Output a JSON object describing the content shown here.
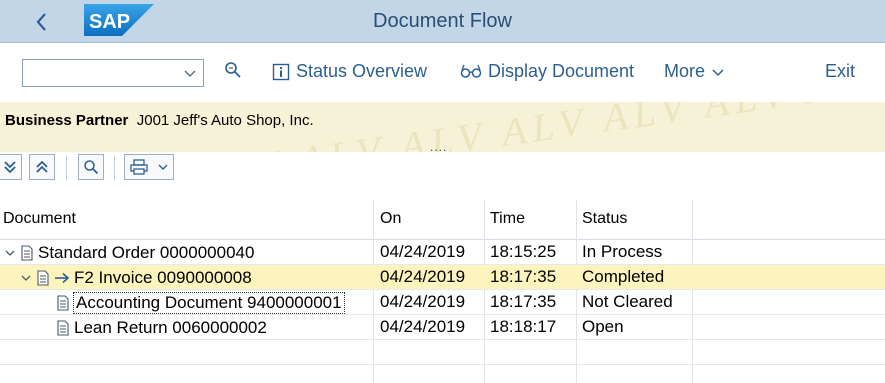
{
  "header": {
    "back_label": "<",
    "logo_text": "SAP",
    "title": "Document Flow"
  },
  "toolbar": {
    "combo_value": "",
    "status_overview": "Status Overview",
    "display_document": "Display Document",
    "more": "More",
    "exit": "Exit"
  },
  "partner": {
    "label": "Business Partner",
    "value": "J001 Jeff's Auto Shop, Inc."
  },
  "watermark": "ALV ALV ALV ALV ALV ALV ALV ALV ALV ALV ALV ALV",
  "splitter": "....",
  "table": {
    "columns": [
      "Document",
      "On",
      "Time",
      "Status"
    ],
    "rows": [
      {
        "document": "Standard Order 0000000040",
        "on": "04/24/2019",
        "time": "18:15:25",
        "status": "In Process"
      },
      {
        "document": "F2 Invoice 0090000008",
        "on": "04/24/2019",
        "time": "18:17:35",
        "status": "Completed"
      },
      {
        "document": "Accounting Document 9400000001",
        "on": "04/24/2019",
        "time": "18:17:35",
        "status": "Not Cleared"
      },
      {
        "document": "Lean Return 0060000002",
        "on": "04/24/2019",
        "time": "18:18:17",
        "status": "Open"
      }
    ]
  },
  "colors": {
    "shell": "#c3d6e8",
    "accent": "#2b5f93",
    "highlight_row": "#fcf3bd",
    "alv_band": "#f6f2d8"
  }
}
